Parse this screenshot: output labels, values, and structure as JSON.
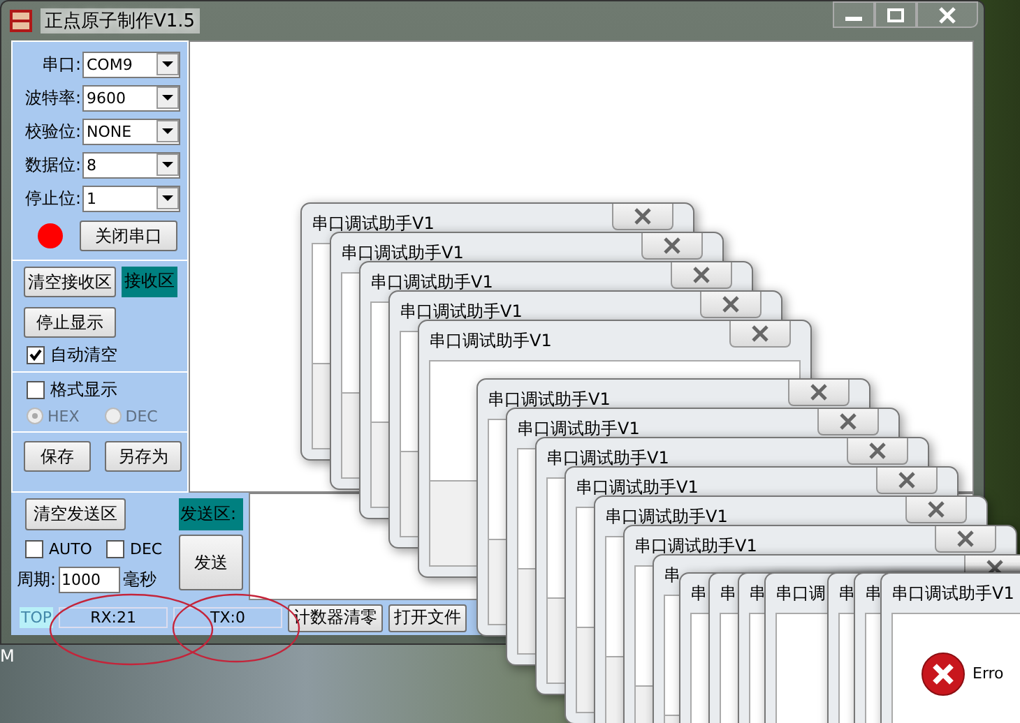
{
  "main_window": {
    "title": "正点原子制作V1.5",
    "settings": [
      {
        "label": "串口:",
        "value": "COM9"
      },
      {
        "label": "波特率:",
        "value": "9600"
      },
      {
        "label": "校验位:",
        "value": "NONE"
      },
      {
        "label": "数据位:",
        "value": "8"
      },
      {
        "label": "停止位:",
        "value": "1"
      }
    ],
    "port_open": true,
    "port_button": "关闭串口",
    "receive": {
      "clear_button": "清空接收区",
      "label": "接收区",
      "stop_button": "停止显示",
      "auto_clear": {
        "label": "自动清空",
        "checked": true
      },
      "format": {
        "label": "格式显示",
        "checked": false
      },
      "radios": [
        {
          "label": "HEX",
          "selected": true,
          "disabled": true
        },
        {
          "label": "DEC",
          "selected": false,
          "disabled": true
        }
      ],
      "save_button": "保存",
      "save_as_button": "另存为"
    },
    "send": {
      "clear_button": "清空发送区",
      "label": "发送区:",
      "options": [
        {
          "label": "AUTO",
          "checked": false
        },
        {
          "label": "DEC",
          "checked": false
        }
      ],
      "period_label": "周期:",
      "period_value": "1000",
      "period_unit": "毫秒",
      "send_button": "发送"
    },
    "status_bar": {
      "top": "TOP",
      "rx": "RX:21",
      "tx": "TX:0",
      "reset_button": "计数器清零",
      "open_file_button": "打开文件"
    }
  },
  "dialogs": [
    {
      "title": "串口调试助手V1"
    },
    {
      "title": "串口调试助手V1"
    },
    {
      "title": "串口调试助手V1"
    },
    {
      "title": "串口调试助手V1"
    },
    {
      "title": "串口调试助手V1"
    },
    {
      "title": "串口调试助手V1"
    },
    {
      "title": "串口调试助手V1"
    },
    {
      "title": "串口调试助手V1"
    },
    {
      "title": "串口调试助手V1"
    },
    {
      "title": "串口调试助手V1"
    },
    {
      "title": "串口调试助手V1"
    },
    {
      "title": "串"
    },
    {
      "title": "串"
    },
    {
      "title": "串"
    },
    {
      "title": "串"
    },
    {
      "title": "串口调"
    },
    {
      "title": "串"
    },
    {
      "title": "串"
    },
    {
      "title": "串口调试助手V1",
      "kind": "error",
      "message": "Erro"
    }
  ],
  "desktop": {
    "label": "M"
  }
}
